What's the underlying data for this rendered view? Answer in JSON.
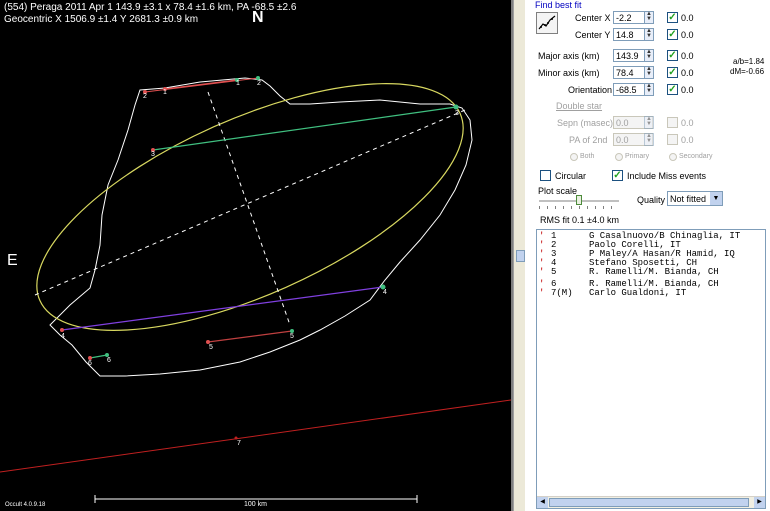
{
  "plot": {
    "title_line1": "(554) Peraga  2011 Apr 1   143.9 ±3.1 x 78.4 ±1.6 km, PA -68.5 ±2.6",
    "title_line2": "Geocentric X 1506.9 ±1.4  Y 2681.3 ±0.9 km",
    "north_label": "N",
    "east_label": "E",
    "version": "Occult 4.0.9.18",
    "scale_label": "100 km",
    "chords": [
      {
        "start_label": "1",
        "end_label": "1",
        "color": "#e05050"
      },
      {
        "start_label": "2",
        "end_label": "2",
        "color": "#e05050"
      },
      {
        "start_label": "3",
        "end_label": "3",
        "color": "#40c080"
      },
      {
        "start_label": "4",
        "end_label": "4",
        "color": "#8040e0"
      },
      {
        "start_label": "5",
        "end_label": "5",
        "color": "#c04040"
      },
      {
        "start_label": "6",
        "end_label": "6",
        "color": "#c04040"
      },
      {
        "start_label": "7",
        "color": "#c02020"
      }
    ],
    "colors": {
      "ellipse": "#d8d860",
      "profile": "#ffffff",
      "axis_dash": "#ffffff",
      "miss_line": "#c02020"
    }
  },
  "panel": {
    "find_best_fit": "Find best fit",
    "center_x": {
      "label": "Center X",
      "value": "-2.2",
      "offset": "0.0",
      "checked": true
    },
    "center_y": {
      "label": "Center Y",
      "value": "14.8",
      "offset": "0.0",
      "checked": true
    },
    "major_axis": {
      "label": "Major axis (km)",
      "value": "143.9",
      "offset": "0.0",
      "checked": true
    },
    "minor_axis": {
      "label": "Minor axis (km)",
      "value": "78.4",
      "offset": "0.0",
      "checked": true
    },
    "orientation": {
      "label": "Orientation",
      "value": "-68.5",
      "offset": "0.0",
      "checked": true
    },
    "ab_ratio": "a/b=1.84",
    "dm": "dM=-0.66",
    "double_star": "Double star",
    "sepn": {
      "label": "Sepn (masec)",
      "value": "0.0",
      "offset": "0.0"
    },
    "pa2": {
      "label": "PA of 2nd",
      "value": "0.0",
      "offset": "0.0"
    },
    "radio_both": "Both",
    "radio_primary": "Primary",
    "radio_secondary": "Secondary",
    "circular": "Circular",
    "include_miss": "Include Miss events",
    "plot_scale": "Plot scale",
    "quality_label": "Quality",
    "quality_value": "Not fitted",
    "rms_fit": "RMS fit 0.1 ±4.0 km",
    "observers": [
      {
        "num": "1",
        "name": "G Casalnuovo/B Chinaglia, IT"
      },
      {
        "num": "2",
        "name": "Paolo Corelli, IT"
      },
      {
        "num": "3",
        "name": "P Maley/A Hasan/R Hamid, IQ"
      },
      {
        "num": "4",
        "name": "Stefano Sposetti, CH"
      },
      {
        "num": "5",
        "name": "R. Ramelli/M. Bianda, CH"
      },
      {
        "num": "6",
        "name": "R. Ramelli/M. Bianda, CH"
      },
      {
        "num": "7(M)",
        "name": "Carlo Gualdoni, IT"
      }
    ],
    "observer_marker_color": "#c00000",
    "toolbar_icon": "chart-icon"
  }
}
